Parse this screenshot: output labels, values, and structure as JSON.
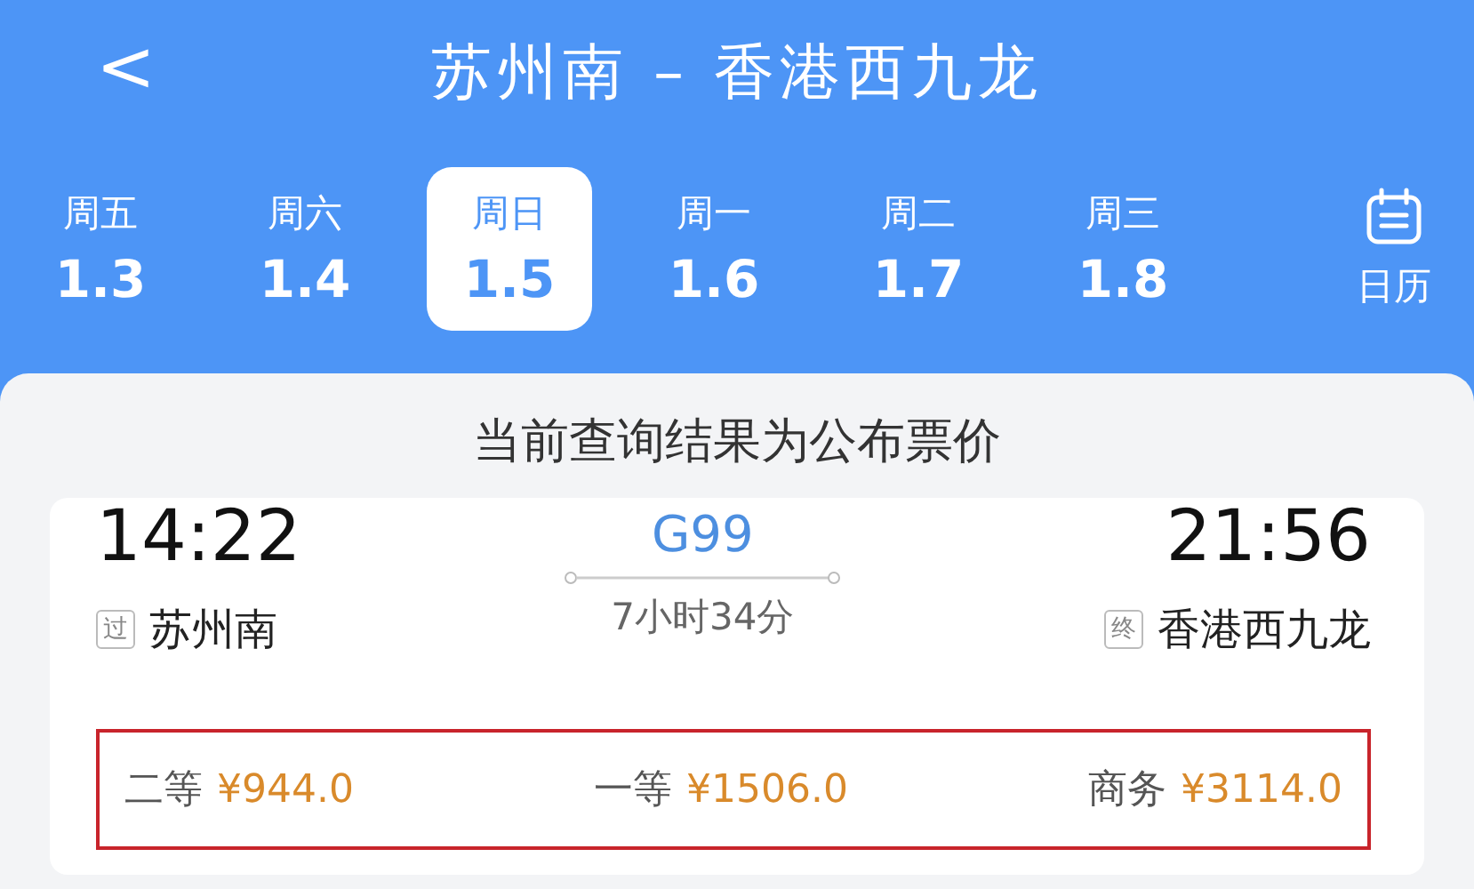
{
  "header": {
    "back": "<",
    "title": "苏州南 – 香港西九龙"
  },
  "dates": [
    {
      "weekday": "周五",
      "date": "1.3",
      "selected": false
    },
    {
      "weekday": "周六",
      "date": "1.4",
      "selected": false
    },
    {
      "weekday": "周日",
      "date": "1.5",
      "selected": true
    },
    {
      "weekday": "周一",
      "date": "1.6",
      "selected": false
    },
    {
      "weekday": "周二",
      "date": "1.7",
      "selected": false
    },
    {
      "weekday": "周三",
      "date": "1.8",
      "selected": false
    }
  ],
  "calendar": {
    "label": "日历"
  },
  "notice": "当前查询结果为公布票价",
  "train": {
    "depart_time": "14:22",
    "depart_tag": "过",
    "depart_station": "苏州南",
    "number": "G99",
    "duration": "7小时34分",
    "arrive_time": "21:56",
    "arrive_tag": "终",
    "arrive_station": "香港西九龙",
    "prices": [
      {
        "class": "二等",
        "price": "¥944.0"
      },
      {
        "class": "一等",
        "price": "¥1506.0"
      },
      {
        "class": "商务",
        "price": "¥3114.0"
      }
    ]
  }
}
